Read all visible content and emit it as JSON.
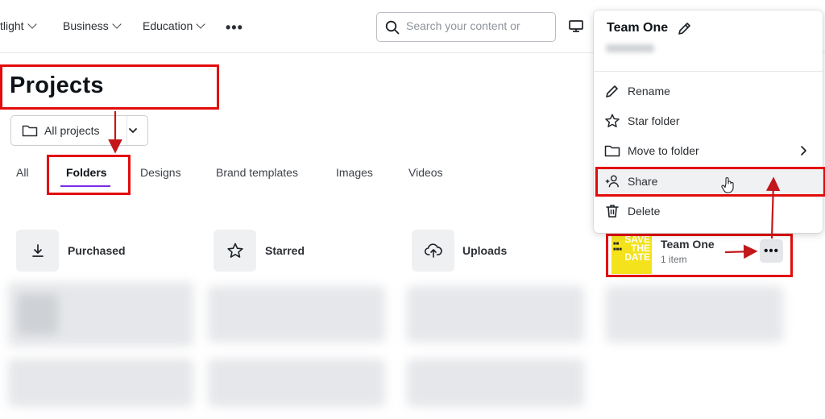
{
  "topbar": {
    "nav": [
      {
        "label": "tlight"
      },
      {
        "label": "Business"
      },
      {
        "label": "Education"
      }
    ],
    "more_icon": "more-horizontal-icon",
    "search": {
      "placeholder": "Search your content or"
    },
    "desktop_icon": "monitor-icon"
  },
  "page": {
    "title": "Projects",
    "filter": {
      "label": "All projects",
      "icon": "folder-icon"
    },
    "tabs": [
      {
        "label": "All"
      },
      {
        "label": "Folders",
        "active": true
      },
      {
        "label": "Designs"
      },
      {
        "label": "Brand templates"
      },
      {
        "label": "Images"
      },
      {
        "label": "Videos"
      }
    ],
    "folders": [
      {
        "label": "Purchased",
        "icon": "download-icon"
      },
      {
        "label": "Starred",
        "icon": "star-icon"
      },
      {
        "label": "Uploads",
        "icon": "cloud-upload-icon"
      }
    ],
    "team_folder": {
      "name": "Team One",
      "count": "1 item",
      "thumb_text": "SAVE THE DATE"
    }
  },
  "context_menu": {
    "title": "Team One",
    "items": [
      {
        "label": "Rename",
        "icon": "pencil-icon"
      },
      {
        "label": "Star folder",
        "icon": "star-icon"
      },
      {
        "label": "Move to folder",
        "icon": "folder-icon"
      },
      {
        "label": "Share",
        "icon": "add-people-icon"
      },
      {
        "label": "Delete",
        "icon": "trash-icon"
      }
    ]
  },
  "colors": {
    "accent": "#7d2ae8",
    "highlight": "#e30b0b",
    "arrow": "#c2181b"
  }
}
